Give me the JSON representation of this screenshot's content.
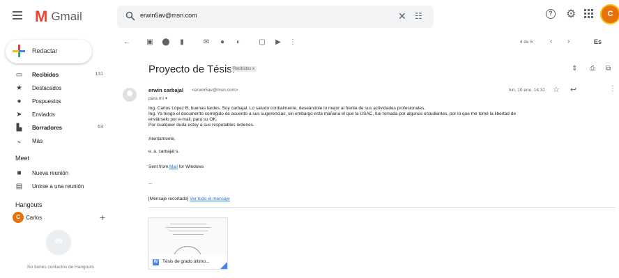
{
  "app": {
    "logo_text": "Gmail",
    "accent": "#ea4335"
  },
  "search": {
    "value": "erwin5av@msn.com"
  },
  "sidebar": {
    "compose_label": "Redactar",
    "items": [
      {
        "label": "Recibidos",
        "count": "131",
        "bold": true,
        "icon": "inbox-icon"
      },
      {
        "label": "Destacados",
        "count": "",
        "bold": false,
        "icon": "star-icon"
      },
      {
        "label": "Pospuestos",
        "count": "",
        "bold": false,
        "icon": "clock-icon"
      },
      {
        "label": "Enviados",
        "count": "",
        "bold": false,
        "icon": "send-icon"
      },
      {
        "label": "Borradores",
        "count": "63",
        "bold": true,
        "icon": "draft-icon"
      },
      {
        "label": "Más",
        "count": "",
        "bold": false,
        "icon": "chevron-down-icon"
      }
    ],
    "meet_title": "Meet",
    "meet_items": [
      {
        "label": "Nueva reunión",
        "icon": "video-icon"
      },
      {
        "label": "Unirse a una reunión",
        "icon": "keyboard-icon"
      }
    ],
    "hangouts_title": "Hangouts",
    "hangout_user": "Carlos",
    "hangout_initial": "C",
    "hangout_empty": "No tienes contactos de Hangouts"
  },
  "toolbar": {
    "pager": "4 de 5",
    "lang": "Es"
  },
  "message": {
    "subject": "Proyecto de Tésis.",
    "label": "Recibidos x",
    "sender_name": "erwin carbajal",
    "sender_email": "<erwin5av@msn.com>",
    "to": "para mí ▾",
    "date": "lun, 10 ene, 14:32",
    "body": [
      "Ing. Carlos López B,  buenas tardes. Soy carbajal. Lo saludo cordialmente, deseándole lo mejor al frente de sus actividades profesionales.",
      "Ing. Ya tengo el documento corregido de acuerdo a sus sugerencias, sin embargo esta mañana el que la USAC, fue tomada por algunos estudiantes, por lo que me tomé la libertad de",
      "enviárselo por e-mail, para su OK.",
      "Por cualquier duda estoy a sus respetables órdenes."
    ],
    "closing": "Atentamente,",
    "signature": "e. a. carbajal s.",
    "sent_from_prefix": "Sent from ",
    "sent_from_link": "Mail",
    "sent_from_suffix": " for Windows",
    "ellipsis": "...",
    "clipped": "[Mensaje recortado]",
    "view_all": "Ver todo el mensaje",
    "attachment_name": "Tésis de grado último...",
    "attachment_icon_letter": "W"
  },
  "user": {
    "initial": "C"
  }
}
